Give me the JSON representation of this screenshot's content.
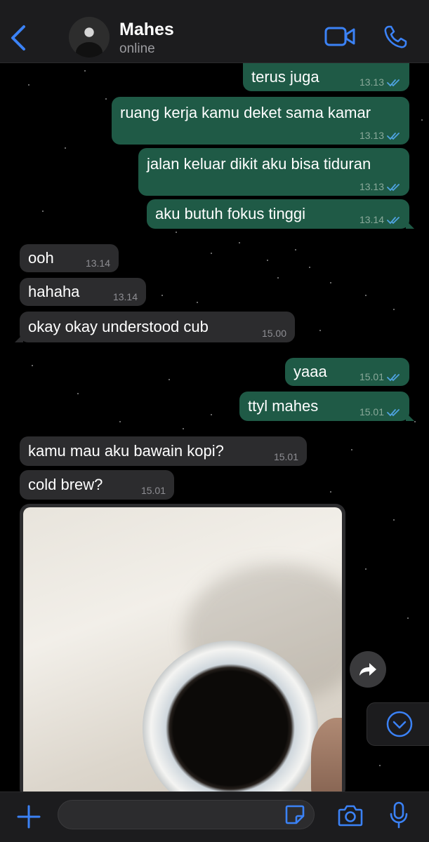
{
  "header": {
    "contact_name": "Mahes",
    "status": "online",
    "icons": [
      "chevron-left-icon",
      "avatar",
      "video-call-icon",
      "phone-icon"
    ]
  },
  "colors": {
    "accent": "#3b82f6",
    "outgoing_bubble": "#1f5a46",
    "incoming_bubble": "#2c2c2e",
    "read_ticks": "#4fa3e0"
  },
  "messages": [
    {
      "direction": "out",
      "text": "terus juga",
      "time": "13.13",
      "read": true
    },
    {
      "direction": "out",
      "text": "ruang kerja kamu deket sama kamar",
      "time": "13.13",
      "read": true
    },
    {
      "direction": "out",
      "text": "jalan keluar dikit aku bisa tiduran",
      "time": "13.13",
      "read": true
    },
    {
      "direction": "out",
      "text": "aku butuh fokus tinggi",
      "time": "13.14",
      "read": true
    },
    {
      "direction": "in",
      "text": "ooh",
      "time": "13.14"
    },
    {
      "direction": "in",
      "text": "hahaha",
      "time": "13.14"
    },
    {
      "direction": "in",
      "text": "okay okay understood cub",
      "time": "15.00"
    },
    {
      "direction": "out",
      "text": "yaaa",
      "time": "15.01",
      "read": true
    },
    {
      "direction": "out",
      "text": "ttyl mahes",
      "time": "15.01",
      "read": true
    },
    {
      "direction": "in",
      "text": "kamu mau aku bawain kopi?",
      "time": "15.01"
    },
    {
      "direction": "in",
      "text": "cold brew?",
      "time": "15.01"
    }
  ],
  "photo_message": {
    "direction": "in",
    "content": "photo of coffee cup"
  },
  "input_bar": {
    "placeholder": "",
    "icons": [
      "plus-icon",
      "sticker-icon",
      "camera-icon",
      "microphone-icon"
    ]
  }
}
